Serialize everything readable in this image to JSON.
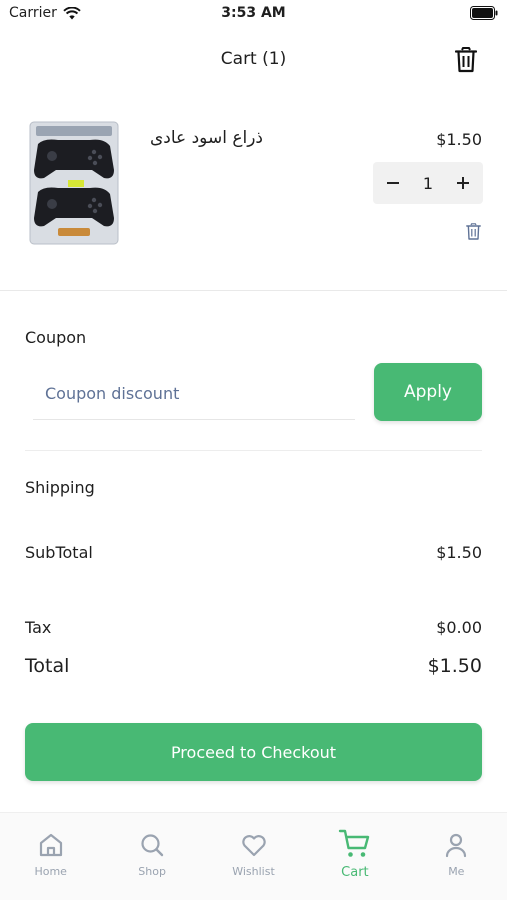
{
  "status_bar": {
    "carrier": "Carrier",
    "time": "3:53 AM"
  },
  "header": {
    "title": "Cart (1)",
    "clear_icon": "trash-icon"
  },
  "cart_items": [
    {
      "name": "ذراع اسود عادى",
      "price": "$1.50",
      "quantity": "1",
      "image": "gamepad-product-image"
    }
  ],
  "coupon": {
    "label": "Coupon",
    "placeholder": "Coupon discount",
    "apply_label": "Apply"
  },
  "summary": {
    "shipping_label": "Shipping",
    "subtotal_label": "SubTotal",
    "subtotal_value": "$1.50",
    "tax_label": "Tax",
    "tax_value": "$0.00",
    "total_label": "Total",
    "total_value": "$1.50"
  },
  "checkout": {
    "label": "Proceed to Checkout"
  },
  "tabs": [
    {
      "label": "Home",
      "icon": "home-icon",
      "active": false
    },
    {
      "label": "Shop",
      "icon": "search-icon",
      "active": false
    },
    {
      "label": "Wishlist",
      "icon": "heart-icon",
      "active": false
    },
    {
      "label": "Cart",
      "icon": "cart-icon",
      "active": true
    },
    {
      "label": "Me",
      "icon": "user-icon",
      "active": false
    }
  ],
  "colors": {
    "accent": "#48b974",
    "inactive_tab": "#9aa3b0",
    "background": "#ffffff"
  }
}
